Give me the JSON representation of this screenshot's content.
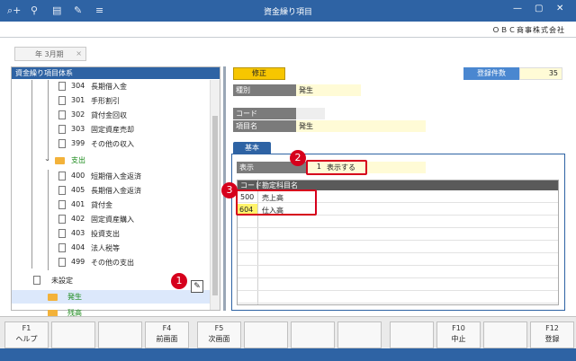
{
  "window": {
    "title": "資金繰り項目",
    "icons": [
      "search-add-icon",
      "zoom-icon",
      "print-icon",
      "tools-icon",
      "menu-icon"
    ],
    "controls": [
      "minimize-icon",
      "restore-icon",
      "close-icon"
    ]
  },
  "company": "ＯＢＣ商事株式会社",
  "period": "年 3月期",
  "left_panel": {
    "title": "資金繰り項目体系",
    "items": [
      {
        "code": "304",
        "name": "長期借入金"
      },
      {
        "code": "301",
        "name": "手形割引"
      },
      {
        "code": "302",
        "name": "貸付金回収"
      },
      {
        "code": "303",
        "name": "固定資産売却"
      },
      {
        "code": "399",
        "name": "その他の収入"
      },
      {
        "code": "",
        "name": "支出"
      },
      {
        "code": "400",
        "name": "短期借入金返済"
      },
      {
        "code": "405",
        "name": "長期借入金返済"
      },
      {
        "code": "401",
        "name": "貸付金"
      },
      {
        "code": "402",
        "name": "固定資産購入"
      },
      {
        "code": "403",
        "name": "投資支出"
      },
      {
        "code": "404",
        "name": "法人税等"
      },
      {
        "code": "499",
        "name": "その他の支出"
      },
      {
        "code": "",
        "name": "未設定"
      },
      {
        "code": "",
        "name": "発生"
      },
      {
        "code": "",
        "name": "残高"
      }
    ]
  },
  "detail": {
    "mode_button": "修正",
    "count_label": "登録件数",
    "count_value": "35",
    "type_label": "種別",
    "type_value": "発生",
    "code_label": "コード",
    "code_value": "",
    "name_label": "項目名",
    "name_value": "発生"
  },
  "basic": {
    "tab_label": "基本",
    "display_label": "表示",
    "display_number": "1",
    "display_value": "表示する",
    "grid_headers": [
      "コード",
      "勘定科目名"
    ],
    "grid_rows": [
      {
        "code": "500",
        "name": "売上高"
      },
      {
        "code": "604",
        "name": "仕入高"
      }
    ]
  },
  "callouts": [
    "1",
    "2",
    "3"
  ],
  "fkeys": [
    {
      "key": "F1",
      "label": "ヘルプ"
    },
    {
      "key": "",
      "label": ""
    },
    {
      "key": "",
      "label": ""
    },
    {
      "key": "F4",
      "label": "前画面"
    },
    {
      "key": "F5",
      "label": "次画面"
    },
    {
      "key": "",
      "label": ""
    },
    {
      "key": "",
      "label": ""
    },
    {
      "key": "",
      "label": ""
    },
    {
      "key": "",
      "label": ""
    },
    {
      "key": "F10",
      "label": "中止"
    },
    {
      "key": "",
      "label": ""
    },
    {
      "key": "F12",
      "label": "登録"
    }
  ],
  "colors": {
    "accent": "#2e63a4",
    "highlight": "#f7c600",
    "callout": "#d6001c",
    "field": "#fffbd6"
  }
}
